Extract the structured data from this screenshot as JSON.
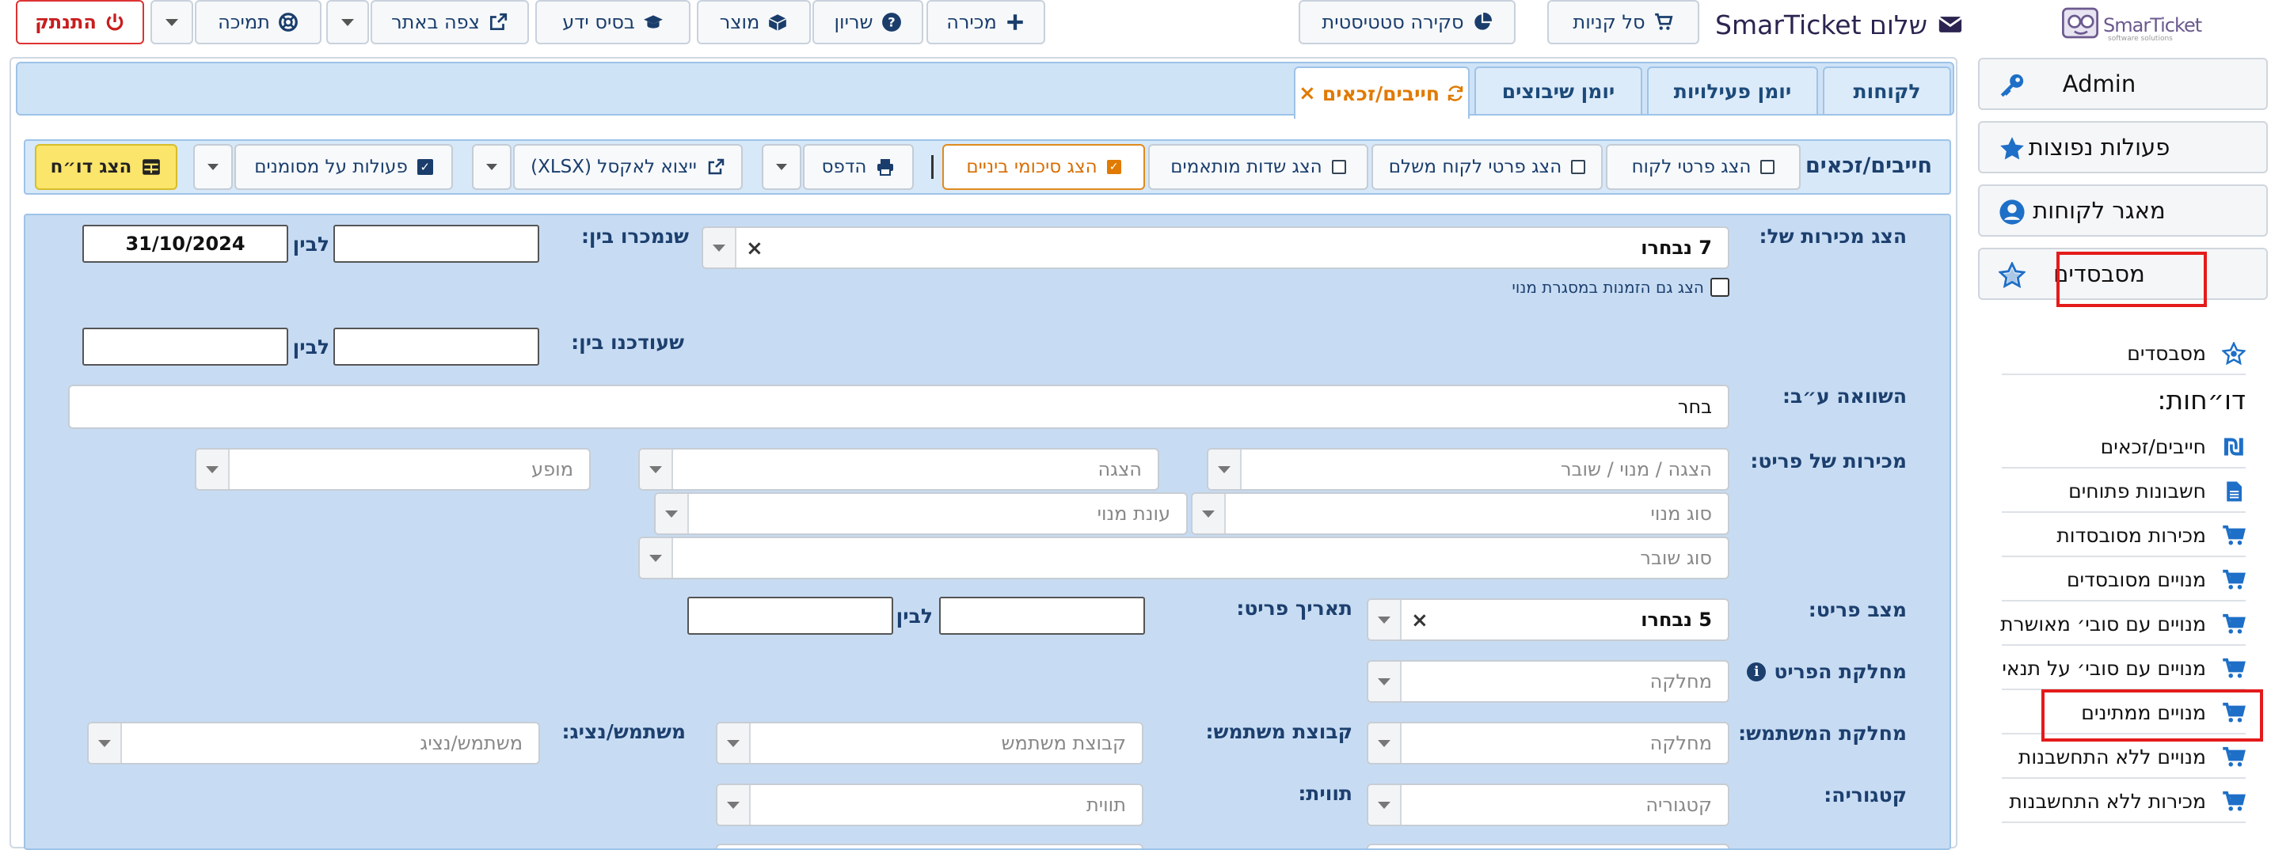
{
  "brand": {
    "logo_text": "SmarTicket",
    "logo_sub": "software solutions"
  },
  "topbar": {
    "greeting": "שלום SmarTicket",
    "cart": "סל קניות",
    "stats": "סקירה סטטיסטית",
    "sale": "מכירה",
    "booking": "שריון",
    "product": "מוצר",
    "knowledge": "בסיס ידע",
    "view_site": "צפה באתר",
    "support": "תמיכה",
    "logout": "התנתק"
  },
  "sidebar": {
    "buttons": [
      {
        "label": "Admin",
        "icon": "key-icon"
      },
      {
        "label": "פעולות נפוצות",
        "icon": "star-icon"
      },
      {
        "label": "מאגר לקוחות",
        "icon": "user-circle-icon"
      },
      {
        "label": "מסבסדים",
        "icon": "star-outline-icon"
      }
    ],
    "submenu_first": "מסבסדים",
    "reports_heading": "דו״חות:",
    "items": [
      {
        "label": "חייבים/זכאים",
        "icon": "shekel-icon"
      },
      {
        "label": "חשבונות פתוחים",
        "icon": "document-icon"
      },
      {
        "label": "מכירות מסובסדות",
        "icon": "cart-icon"
      },
      {
        "label": "מנויים מסובסדים",
        "icon": "cart-icon"
      },
      {
        "label": "מנויים עם סובי׳ מאושרת",
        "icon": "cart-icon"
      },
      {
        "label": "מנויים עם סובי׳ על תנאי",
        "icon": "cart-icon"
      },
      {
        "label": "מנויים ממתינים",
        "icon": "cart-icon"
      },
      {
        "label": "מנויים ללא התחשבנות",
        "icon": "cart-icon"
      },
      {
        "label": "מכירות ללא התחשבנות",
        "icon": "cart-icon"
      }
    ]
  },
  "tabs": [
    {
      "label": "לקוחות"
    },
    {
      "label": "יומן פעילויות"
    },
    {
      "label": "יומן שיבוצים"
    },
    {
      "label": "חייבים/זכאים",
      "active": true
    }
  ],
  "toolbar": {
    "title": "חייבים/זכאים",
    "show_customer": "הצג פרטי לקוח",
    "show_payer": "הצג פרטי לקוח משלם",
    "show_custom": "הצג שדות מותאמים",
    "show_subtotals": "הצג סיכומי ביניים",
    "print": "הדפס",
    "export": "ייצוא לאקסל (XLSX)",
    "actions": "פעולות על מסומנים",
    "show_report": "הצג דו״ח"
  },
  "form": {
    "sales_of_label": "הצג מכירות של:",
    "sales_of_value": "7 נבחרו",
    "include_sub_label": "הצג גם הזמנות במסגרת מנוי",
    "sold_between_label": "שנמכרו בין:",
    "between": "לבין",
    "sold_to": "31/10/2024",
    "updated_between_label": "שעודכנו בין:",
    "compare_by_label": "השוואה ע״ב:",
    "compare_by_value": "בחר",
    "item_sales_label": "מכירות של פריט:",
    "ph_show_sub_voucher": "הצגה / מנוי / שובר",
    "ph_show": "הצגה",
    "ph_performance": "מופע",
    "ph_sub_type": "סוג מנוי",
    "ph_sub_season": "עונת מנוי",
    "ph_voucher_type": "סוג שובר",
    "item_status_label": "מצב פריט:",
    "item_status_value": "5 נבחרו",
    "item_date_label": "תאריך פריט:",
    "item_dept_label": "מחלקת הפריט",
    "ph_dept": "מחלקה",
    "user_dept_label": "מחלקת המשתמש:",
    "user_group_label": "קבוצת משתמש:",
    "ph_user_group": "קבוצת משתמש",
    "user_rep_label": "משתמש/נציג:",
    "ph_user_rep": "משתמש/נציג",
    "category_label": "קטגוריה:",
    "ph_category": "קטגוריה",
    "tag_label": "תווית:",
    "ph_tag": "תווית"
  }
}
